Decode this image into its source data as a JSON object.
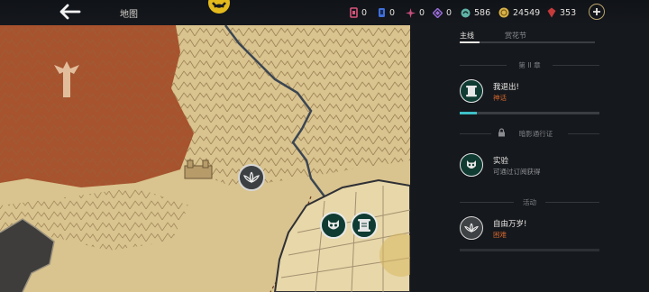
{
  "header": {
    "title": "地图",
    "resources": [
      {
        "icon": "card-icon",
        "value": "0",
        "color": "#d9547a"
      },
      {
        "icon": "ticket-icon",
        "value": "0",
        "color": "#3f6fd8"
      },
      {
        "icon": "sparkle-icon",
        "value": "0",
        "color": "#c94f7f"
      },
      {
        "icon": "crystal-icon",
        "value": "0",
        "color": "#9a6cd8"
      },
      {
        "icon": "swirl-icon",
        "value": "586",
        "color": "#5fb3a6"
      },
      {
        "icon": "coin-icon",
        "value": "24549",
        "color": "#d9b24a"
      },
      {
        "icon": "gem-icon",
        "value": "353",
        "color": "#c63a3a"
      }
    ]
  },
  "tabs": {
    "main": "主线",
    "other": "赏花节"
  },
  "sections": {
    "chapter": "第 II 章",
    "locked": "暗影通行证",
    "event": "活动"
  },
  "quests": [
    {
      "icon": "scroll-icon",
      "name": "我退出!",
      "subtitle": "神话",
      "progress": 0.12
    },
    {
      "icon": "demon-mask-icon",
      "name": "实验",
      "subtitle": "可通过订阅获得"
    },
    {
      "icon": "lotus-icon",
      "name": "自由万岁!",
      "subtitle": "困难"
    }
  ],
  "colors": {
    "accent": "#3ec0c8",
    "orange": "#d0642c",
    "panel": "#15181d",
    "parchment": "#d9c38e"
  }
}
